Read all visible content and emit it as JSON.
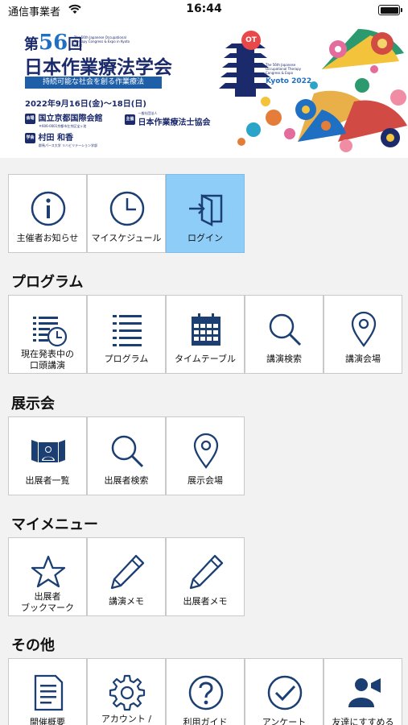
{
  "status_bar": {
    "carrier": "通信事業者",
    "time": "16:44"
  },
  "banner": {
    "edition_prefix": "第",
    "edition_number": "56",
    "edition_suffix": "回",
    "english_title": "The 56th Japanese Occupational Therapy Congress & Expo in Kyoto 2022",
    "title": "日本作業療法学会",
    "subtitle": "持続可能な社会を創る作業療法",
    "dates": "2022年9月16日(金)～18日(日)",
    "venue_tag": "会場",
    "venue": "国立京都国際会館",
    "venue_address": "〒606-0001京都市左京区宝ヶ池",
    "organizer_tag": "主催",
    "organizer_prefix": "一般社団法人",
    "organizer": "日本作業療法士協会",
    "chair_tag": "学会長",
    "chair": "村田 和香",
    "chair_affiliation": "群馬パース大学 リハビリテーション学部",
    "logo_badge": "OT",
    "kyoto_english": "The 56th Japanese Occupational Therapy Congress & Expo",
    "kyoto_label": "Kyoto 2022"
  },
  "top_tiles": [
    {
      "label": "主催者お知らせ",
      "icon": "info-icon"
    },
    {
      "label": "マイスケジュール",
      "icon": "clock-icon"
    },
    {
      "label": "ログイン",
      "icon": "login-icon"
    }
  ],
  "sections": {
    "program": {
      "title": "プログラム",
      "tiles": [
        {
          "label_line1": "現在発表中の",
          "label_line2": "口頭講演",
          "icon": "list-clock-icon"
        },
        {
          "label": "プログラム",
          "icon": "list-icon"
        },
        {
          "label": "タイムテーブル",
          "icon": "calendar-icon"
        },
        {
          "label": "講演検索",
          "icon": "search-icon"
        },
        {
          "label": "講演会場",
          "icon": "map-pin-icon"
        }
      ]
    },
    "exhibition": {
      "title": "展示会",
      "tiles": [
        {
          "label": "出展者一覧",
          "icon": "exhibitor-booth-icon"
        },
        {
          "label": "出展者検索",
          "icon": "search-icon"
        },
        {
          "label": "展示会場",
          "icon": "map-pin-icon"
        }
      ]
    },
    "my_menu": {
      "title": "マイメニュー",
      "tiles": [
        {
          "label_line1": "出展者",
          "label_line2": "ブックマーク",
          "icon": "star-icon"
        },
        {
          "label": "講演メモ",
          "icon": "pencil-icon"
        },
        {
          "label": "出展者メモ",
          "icon": "pencil-icon"
        }
      ]
    },
    "other": {
      "title": "その他",
      "tiles": [
        {
          "label": "開催概要",
          "icon": "document-icon"
        },
        {
          "label": "アカウント /",
          "icon": "gear-icon"
        },
        {
          "label": "利用ガイド",
          "icon": "help-icon"
        },
        {
          "label": "アンケート",
          "icon": "check-circle-icon"
        },
        {
          "label": "友達にすすめる",
          "icon": "recommend-icon"
        }
      ]
    }
  },
  "colors": {
    "icon": "#1c3f73",
    "active_tile": "#8ecdf8",
    "background": "#f2f2f2"
  }
}
